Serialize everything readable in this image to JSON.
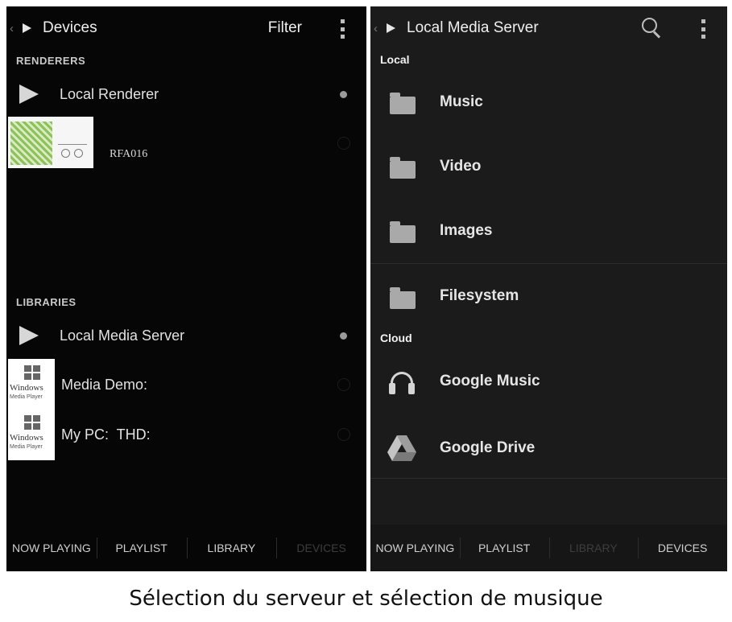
{
  "left": {
    "topbar": {
      "back_glyph": "‹",
      "title": "Devices",
      "filter_label": "Filter"
    },
    "renderers_header": "RENDERERS",
    "renderers": [
      {
        "label": "Local Renderer",
        "selected": true
      },
      {
        "label": "RFA016",
        "selected": false
      }
    ],
    "libraries_header": "LIBRARIES",
    "libraries": [
      {
        "label": "Local Media Server",
        "selected": true
      },
      {
        "label": "Media Demo:",
        "selected": false
      },
      {
        "label": "My PC:  THD:",
        "selected": false
      }
    ],
    "wmp_logo_text": "Windows",
    "wmp_logo_sub": "Media Player",
    "tabs": [
      "NOW PLAYING",
      "PLAYLIST",
      "LIBRARY",
      "DEVICES"
    ],
    "active_tab_dimmed": "DEVICES"
  },
  "right": {
    "topbar": {
      "back_glyph": "‹",
      "title": "Local Media Server"
    },
    "local_label": "Local",
    "local_items": [
      "Music",
      "Video",
      "Images",
      "Filesystem"
    ],
    "cloud_label": "Cloud",
    "cloud_items": [
      "Google Music",
      "Google Drive"
    ],
    "tabs": [
      "NOW PLAYING",
      "PLAYLIST",
      "LIBRARY",
      "DEVICES"
    ],
    "active_tab_dimmed": "LIBRARY"
  },
  "caption": "Sélection du serveur et sélection de musique",
  "icons": [
    "back-chevron-icon",
    "play-icon",
    "overflow-menu-icon",
    "search-icon",
    "folder-icon",
    "headphones-icon",
    "google-drive-icon",
    "windows-media-player-icon"
  ],
  "colors": {
    "screen_bg": "#060606",
    "panel_bg": "#1b1b1b",
    "text": "#e6e6e6",
    "dim_tab": "#3d3d3d"
  }
}
